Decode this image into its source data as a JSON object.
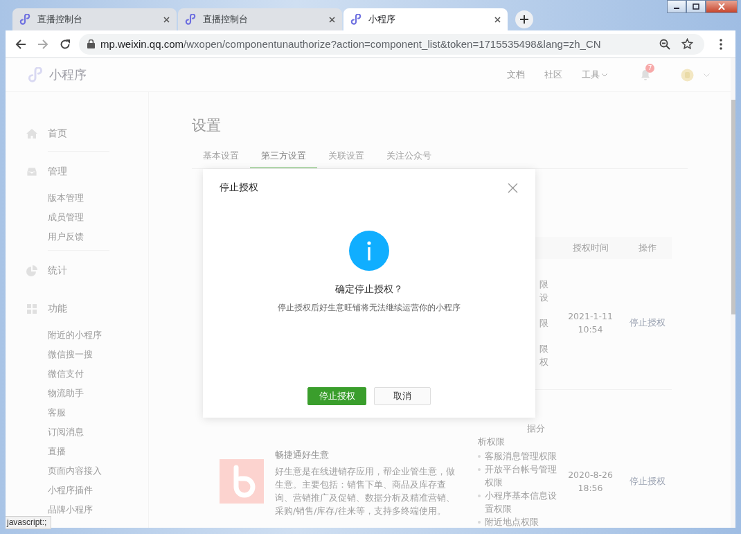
{
  "browser": {
    "tabs": [
      {
        "title": "直播控制台",
        "selected": false
      },
      {
        "title": "直播控制台",
        "selected": false
      },
      {
        "title": "小程序",
        "selected": true
      }
    ],
    "url": {
      "domain": "mp.weixin.qq.com",
      "path": "/wxopen/componentunauthorize?action=component_list&token=1715535498&lang=zh_CN"
    },
    "status_text": "javascript:;"
  },
  "header": {
    "logo_text": "小程序",
    "links": [
      {
        "label": "文档",
        "dropdown": false
      },
      {
        "label": "社区",
        "dropdown": false
      },
      {
        "label": "工具",
        "dropdown": true
      }
    ],
    "notification_count": "7"
  },
  "sidebar": {
    "sections": [
      {
        "kind": "home",
        "label": "首页",
        "divider_after": true
      },
      {
        "kind": "manage",
        "label": "管理",
        "items": [
          "版本管理",
          "成员管理",
          "用户反馈"
        ],
        "divider_after": true
      },
      {
        "kind": "stats",
        "label": "统计",
        "divider_after": false
      },
      {
        "kind": "features",
        "label": "功能",
        "items": [
          "附近的小程序",
          "微信搜一搜",
          "微信支付",
          "物流助手",
          "客服",
          "订阅消息",
          "直播",
          "页面内容接入",
          "小程序插件",
          "品牌小程序"
        ],
        "divider_after": false
      }
    ]
  },
  "page": {
    "title": "设置",
    "tabs": [
      {
        "label": "基本设置",
        "selected": false
      },
      {
        "label": "第三方设置",
        "selected": true
      },
      {
        "label": "关联设置",
        "selected": false
      },
      {
        "label": "关注公众号",
        "selected": false
      }
    ],
    "table": {
      "columns": [
        "授权时间",
        "操作"
      ],
      "rows": [
        {
          "permission_fragments": [
            [
              "限",
              "设"
            ],
            [
              "限"
            ],
            [
              "限",
              "权"
            ]
          ],
          "date": "2021-1-11",
          "time": "10:54",
          "action": "停止授权"
        },
        {
          "name": "畅捷通好生意",
          "description": "好生意是在线进销存应用，帮企业管生意，做生意。主要包括：销售下单、商品及库存查询、营销推广及促销、数据分析及精准营销、采购/销售/库存/往来等，支持多终端使用。",
          "permission_continuation": [
            "据分",
            "析权限"
          ],
          "permissions": [
            "客服消息管理权限",
            "开放平台帐号管理权限",
            "小程序基本信息设置权限",
            "附近地点权限"
          ],
          "date": "2020-8-26",
          "time": "18:56",
          "action": "停止授权"
        }
      ]
    }
  },
  "dialog": {
    "title": "停止授权",
    "heading": "确定停止授权？",
    "message": "停止授权后好生意旺铺将无法继续运营你的小程序",
    "buttons": [
      {
        "label": "停止授权",
        "kind": "primary"
      },
      {
        "label": "取消",
        "kind": "default"
      }
    ]
  }
}
